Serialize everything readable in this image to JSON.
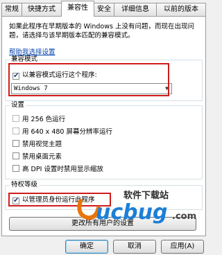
{
  "tabs": [
    "常规",
    "快捷方式",
    "兼容性",
    "安全",
    "详细信息",
    "以前的版本"
  ],
  "active_tab": "兼容性",
  "description": "如果此程序在早期版本的 Windows 上没有问题，而现在出现问题，请选择与该早期版本匹配的兼容模式。",
  "help_link": "帮助我选择设置",
  "compat_group": {
    "title": "兼容模式",
    "checkbox_label": "以兼容模式运行这个程序:",
    "checked": true,
    "selected_os": "Windows 7"
  },
  "settings_group": {
    "title": "设置",
    "options": [
      {
        "label": "用 256 色运行",
        "checked": false
      },
      {
        "label": "用 640 x 480 屏幕分辨率运行",
        "checked": false
      },
      {
        "label": "禁用视觉主题",
        "checked": false
      },
      {
        "label": "禁用桌面元素",
        "checked": false
      },
      {
        "label": "高 DPI 设置时禁用显示缩放",
        "checked": false
      }
    ]
  },
  "privilege_group": {
    "title": "特权等级",
    "checkbox_label": "以管理员身份运行此程序",
    "checked": true
  },
  "change_all_button": "更改所有用户的设置",
  "watermark": {
    "name": "软件下载站",
    "brand": "ucbug",
    "suffix": ".com"
  },
  "buttons": {
    "ok": "确定",
    "cancel": "取消",
    "apply": "应用(A)"
  },
  "colors": {
    "highlight_box": "#d01c1c",
    "link": "#0645ad"
  }
}
